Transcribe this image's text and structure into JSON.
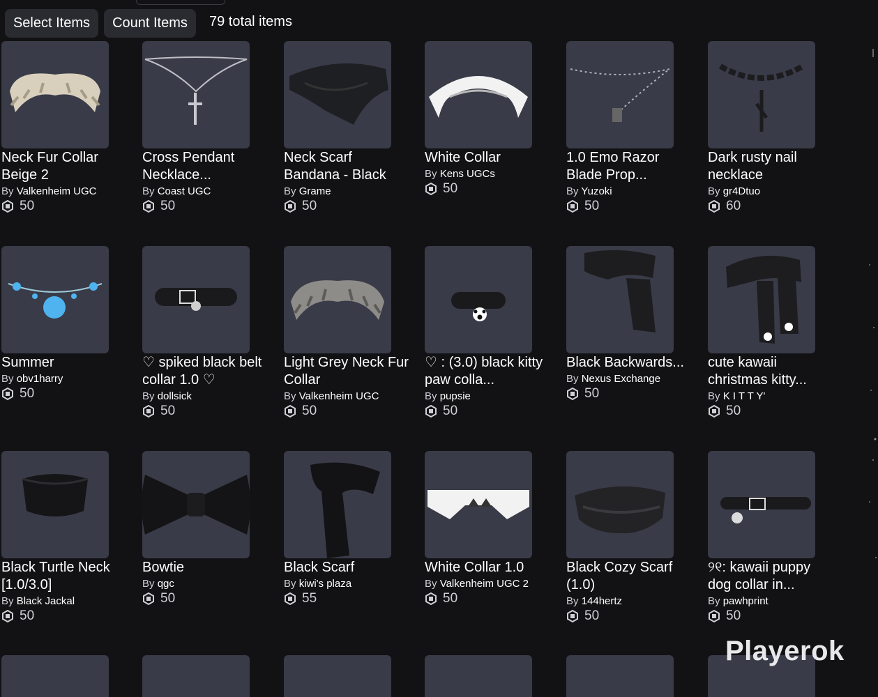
{
  "toolbar": {
    "select_label": "Select Items",
    "count_label": "Count Items",
    "total_text": "79 total items"
  },
  "by_prefix": "By",
  "items": [
    {
      "name": "Neck Fur Collar Beige 2",
      "creator": "Valkenheim UGC",
      "price": "50",
      "icon": "fur-collar-beige"
    },
    {
      "name": "Cross Pendant Necklace...",
      "creator": "Coast UGC",
      "price": "50",
      "icon": "cross-pendant"
    },
    {
      "name": "Neck Scarf Bandana - Black",
      "creator": "Grame",
      "price": "50",
      "icon": "bandana-black"
    },
    {
      "name": "White Collar",
      "creator": "Kens UGCs",
      "price": "50",
      "icon": "white-collar"
    },
    {
      "name": "1.0 Emo Razor Blade Prop...",
      "creator": "Yuzoki",
      "price": "50",
      "icon": "razor-necklace"
    },
    {
      "name": "Dark rusty nail necklace",
      "creator": "gr4Dtuo",
      "price": "60",
      "icon": "chain-necklace"
    },
    {
      "name": "Summer",
      "creator": "obv1harry",
      "price": "50",
      "icon": "flower-necklace"
    },
    {
      "name": "♡ spiked black belt collar 1.0 ♡",
      "creator": "dollsick",
      "price": "50",
      "icon": "belt-collar"
    },
    {
      "name": "Light Grey Neck Fur Collar",
      "creator": "Valkenheim UGC",
      "price": "50",
      "icon": "fur-collar-grey"
    },
    {
      "name": "♡ : (3.0) black kitty paw colla...",
      "creator": "pupsie",
      "price": "50",
      "icon": "paw-collar"
    },
    {
      "name": "Black Backwards...",
      "creator": "Nexus Exchange",
      "price": "50",
      "icon": "black-scarf-back"
    },
    {
      "name": "cute kawaii christmas kitty...",
      "creator": "K I T T Y'",
      "price": "50",
      "icon": "kitty-scarf"
    },
    {
      "name": "Black Turtle Neck [1.0/3.0]",
      "creator": "Black Jackal",
      "price": "50",
      "icon": "turtle-neck"
    },
    {
      "name": "Bowtie",
      "creator": "qgc",
      "price": "50",
      "icon": "bowtie"
    },
    {
      "name": "Black Scarf",
      "creator": "kiwi's plaza",
      "price": "55",
      "icon": "black-scarf"
    },
    {
      "name": "White Collar 1.0",
      "creator": "Valkenheim UGC 2",
      "price": "50",
      "icon": "white-collar-flat"
    },
    {
      "name": "Black Cozy Scarf (1.0)",
      "creator": "144hertz",
      "price": "50",
      "icon": "cozy-scarf"
    },
    {
      "name": "୨୧: kawaii puppy dog collar in...",
      "creator": "pawhprint",
      "price": "50",
      "icon": "puppy-collar"
    }
  ],
  "watermark": "Playerok",
  "colors": {
    "background": "#121214",
    "card": "#393b48",
    "button": "#2a2b31"
  }
}
